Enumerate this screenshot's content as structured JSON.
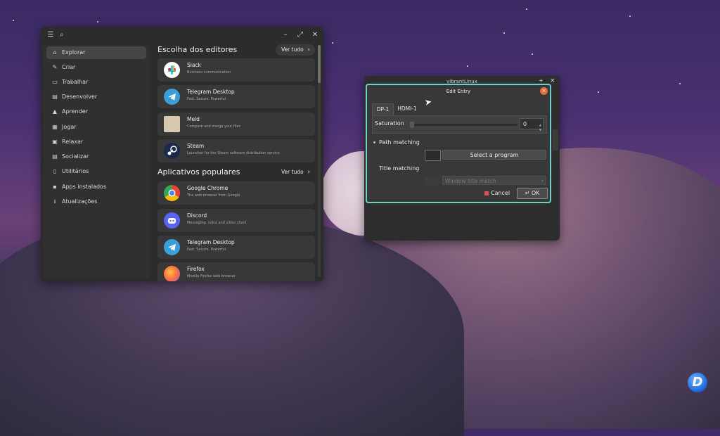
{
  "software": {
    "sidebar": [
      {
        "label": "Explorar",
        "icon": "home-icon",
        "active": true
      },
      {
        "label": "Criar",
        "icon": "create-icon"
      },
      {
        "label": "Trabalhar",
        "icon": "work-icon"
      },
      {
        "label": "Desenvolver",
        "icon": "develop-icon"
      },
      {
        "label": "Aprender",
        "icon": "learn-icon"
      },
      {
        "label": "Jogar",
        "icon": "game-icon"
      },
      {
        "label": "Relaxar",
        "icon": "relax-icon"
      },
      {
        "label": "Socializar",
        "icon": "social-icon"
      },
      {
        "label": "Utilitários",
        "icon": "utilities-icon"
      },
      {
        "label": "Apps instalados",
        "icon": "installed-icon"
      },
      {
        "label": "Atualizações",
        "icon": "updates-icon"
      }
    ],
    "editors": {
      "title": "Escolha dos editores",
      "see_all": "Ver tudo",
      "apps": [
        {
          "name": "Slack",
          "desc": "Business communication"
        },
        {
          "name": "Telegram Desktop",
          "desc": "Fast. Secure. Powerful."
        },
        {
          "name": "Meld",
          "desc": "Compare and merge your files"
        },
        {
          "name": "Steam",
          "desc": "Launcher for the Steam software distribution service"
        }
      ]
    },
    "popular": {
      "title": "Aplicativos populares",
      "see_all": "Ver tudo",
      "apps": [
        {
          "name": "Google Chrome",
          "desc": "The web browser from Google"
        },
        {
          "name": "Discord",
          "desc": "Messaging, voice and video client"
        },
        {
          "name": "Telegram Desktop",
          "desc": "Fast. Secure. Powerful."
        },
        {
          "name": "Firefox",
          "desc": "Mozilla Firefox web browser"
        }
      ]
    }
  },
  "vibrant": {
    "title": "vibrantLinux",
    "close": "×",
    "minimize": "+"
  },
  "dialog": {
    "title": "Edit Entry",
    "tabs": [
      "DP-1",
      "HDMI-1"
    ],
    "saturation_label": "Saturation",
    "saturation_value": "0",
    "path_matching": "Path matching",
    "select_program": "Select a program",
    "title_matching": "Title matching",
    "window_title_placeholder": "Window title match",
    "cancel": "Cancel",
    "ok": "OK"
  }
}
